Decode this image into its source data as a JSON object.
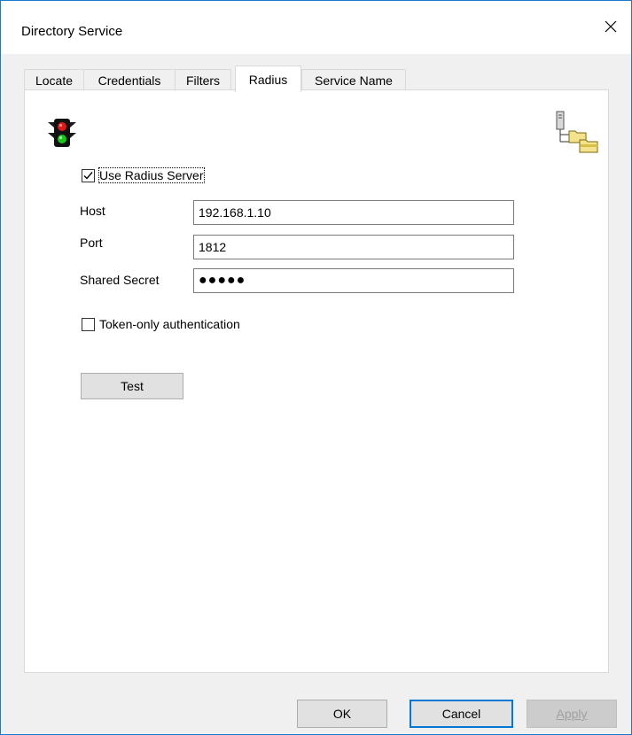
{
  "window": {
    "title": "Directory Service"
  },
  "tabs": [
    {
      "label": "Locate"
    },
    {
      "label": "Credentials"
    },
    {
      "label": "Filters"
    },
    {
      "label": "Radius",
      "active": true
    },
    {
      "label": "Service Name"
    }
  ],
  "icons": {
    "traffic": "traffic-light-icon",
    "folders": "network-folders-icon",
    "close": "close-icon"
  },
  "radius": {
    "use_server": {
      "label": "Use Radius Server",
      "checked": true
    },
    "host": {
      "label": "Host",
      "value": "192.168.1.10"
    },
    "port": {
      "label": "Port",
      "value": "1812"
    },
    "secret": {
      "label": "Shared Secret",
      "value": "●●●●●"
    },
    "token_only": {
      "label": "Token-only authentication",
      "checked": false
    },
    "test_label": "Test"
  },
  "footer": {
    "ok_label": "OK",
    "cancel_label": "Cancel",
    "apply_label": "Apply",
    "apply_disabled": true
  },
  "colors": {
    "accent": "#0078d7",
    "window_border": "#1979ca",
    "panel_bg": "#ffffff",
    "dialog_bg": "#f0f0f0"
  }
}
